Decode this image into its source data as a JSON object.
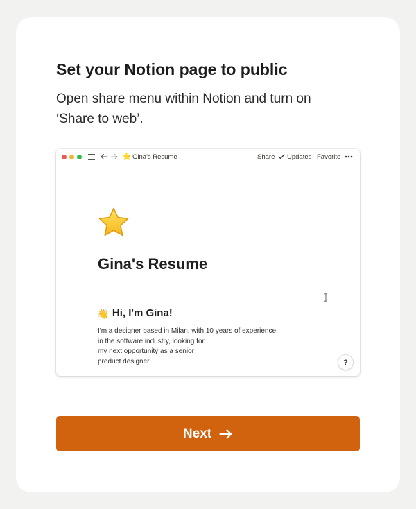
{
  "colors": {
    "background": "#f2f2f0",
    "card": "#ffffff",
    "accent": "#d1620e",
    "traffic_red": "#ee5b56",
    "traffic_yellow": "#f0b52f",
    "traffic_green": "#31b94a"
  },
  "step": {
    "title": "Set your Notion page to public",
    "subtitle": "Open share menu within Notion and turn on ‘Share to web’."
  },
  "preview": {
    "topbar": {
      "page_icon": "⭐",
      "breadcrumb": "Gina's Resume",
      "share": "Share",
      "updates": "Updates",
      "favorite": "Favorite"
    },
    "page": {
      "icon": "star-icon",
      "title": "Gina's Resume",
      "heading_emoji": "👋",
      "heading": "Hi, I'm Gina!",
      "bio_lines": [
        "I'm a designer based in Milan, with 10 years of experience",
        "in the software industry, looking for",
        "my next opportunity as a senior",
        "product designer."
      ],
      "help": "?"
    }
  },
  "next_button": {
    "label": "Next"
  }
}
